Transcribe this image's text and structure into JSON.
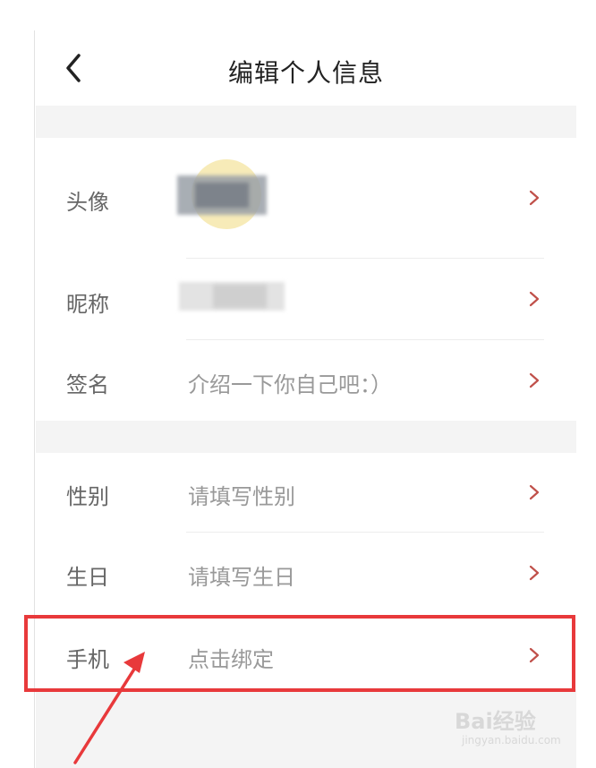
{
  "header": {
    "title": "编辑个人信息"
  },
  "rows": [
    {
      "label": "头像",
      "value": ""
    },
    {
      "label": "昵称",
      "value": ""
    },
    {
      "label": "签名",
      "value": "介绍一下你自己吧：）"
    },
    {
      "label": "性别",
      "value": "请填写性别"
    },
    {
      "label": "生日",
      "value": "请填写生日"
    },
    {
      "label": "手机",
      "value": "点击绑定"
    }
  ],
  "watermark": {
    "main": "Bai经验",
    "sub": "jingyan.baidu.com"
  },
  "colors": {
    "highlight": "#e8393b",
    "chevron": "#c0504a",
    "section_gap": "#f4f4f4"
  },
  "icons": {
    "back": "chevron-left-icon",
    "row_arrow": "chevron-right-icon"
  }
}
